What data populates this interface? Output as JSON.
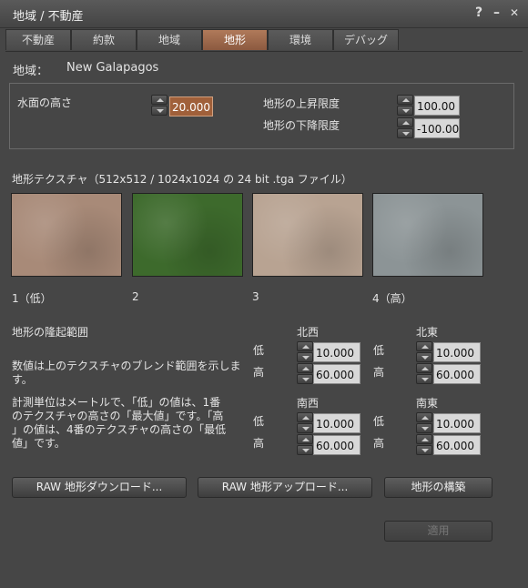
{
  "window": {
    "title": "地域 / 不動産",
    "help": "?",
    "minimize": "–",
    "close": "✕"
  },
  "tabs": [
    "不動産",
    "約款",
    "地域",
    "地形",
    "環境",
    "デバッグ"
  ],
  "active_tab": "地形",
  "region": {
    "label": "地域：",
    "name": "New Galapagos"
  },
  "water": {
    "label": "水面の高さ",
    "value": "20.000"
  },
  "terrain_raise": {
    "label": "地形の上昇限度",
    "value": "100.00"
  },
  "terrain_lower": {
    "label": "地形の下降限度",
    "value": "-100.00"
  },
  "textures": {
    "heading": "地形テクスチャ（512x512 / 1024x1024 の 24 bit .tga ファイル）",
    "items": [
      {
        "label": "1（低）",
        "color": "#a88a78"
      },
      {
        "label": "2",
        "color": "#3d6a2c"
      },
      {
        "label": "3",
        "color": "#b8a392"
      },
      {
        "label": "4（高）",
        "color": "#8c9496"
      }
    ]
  },
  "elevation": {
    "heading": "地形の隆起範囲",
    "desc1": [
      "数値は上のテクスチャのブレンド範囲を示しま",
      "す。"
    ],
    "desc2": [
      "計測単位はメートルで、「低」の値は、1番",
      "のテクスチャの高さの「最大値」です。「高",
      "」の値は、4番のテクスチャの高さの「最低",
      "値」です。"
    ],
    "low": "低",
    "high": "高",
    "corners": [
      {
        "name": "北西",
        "low": "10.000",
        "high": "60.000"
      },
      {
        "name": "北東",
        "low": "10.000",
        "high": "60.000"
      },
      {
        "name": "南西",
        "low": "10.000",
        "high": "60.000"
      },
      {
        "name": "南東",
        "low": "10.000",
        "high": "60.000"
      }
    ]
  },
  "buttons": {
    "download": "RAW 地形ダウンロード...",
    "upload": "RAW 地形アップロード...",
    "bake": "地形の構築",
    "apply": "適用"
  }
}
